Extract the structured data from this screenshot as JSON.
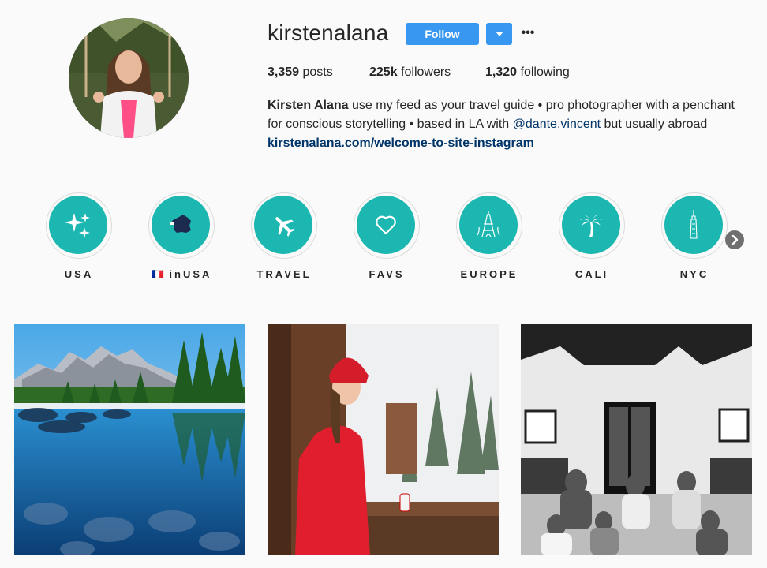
{
  "profile": {
    "username": "kirstenalana",
    "follow_label": "Follow",
    "more_label": "•••",
    "stats": {
      "posts_count": "3,359",
      "posts_label": "posts",
      "followers_count": "225k",
      "followers_label": "followers",
      "following_count": "1,320",
      "following_label": "following"
    },
    "bio": {
      "name": "Kirsten Alana",
      "text1": " use my feed as your travel guide • pro photographer with a penchant for conscious storytelling • based in LA with ",
      "mention": "@dante.vincent",
      "text2": " but usually abroad",
      "website": "kirstenalana.com/welcome-to-site-instagram"
    }
  },
  "highlights": [
    {
      "label": "USA",
      "icon": "sparkles-icon"
    },
    {
      "flag": "🇫🇷",
      "label": "inUSA",
      "icon": "france-map-icon"
    },
    {
      "label": "TRAVEL",
      "icon": "airplane-icon"
    },
    {
      "label": "FAVS",
      "icon": "heart-icon"
    },
    {
      "label": "EUROPE",
      "icon": "eiffel-tower-icon"
    },
    {
      "label": "CALI",
      "icon": "palm-tree-icon"
    },
    {
      "label": "NYC",
      "icon": "skyscraper-icon"
    }
  ],
  "posts": [
    {
      "subject": "mountain lake reflection"
    },
    {
      "subject": "woman in red jacket on snowy balcony"
    },
    {
      "subject": "black and white group in living room"
    }
  ],
  "colors": {
    "accent": "#3897f0",
    "highlight_teal": "#1bb7b0",
    "link": "#003569"
  }
}
